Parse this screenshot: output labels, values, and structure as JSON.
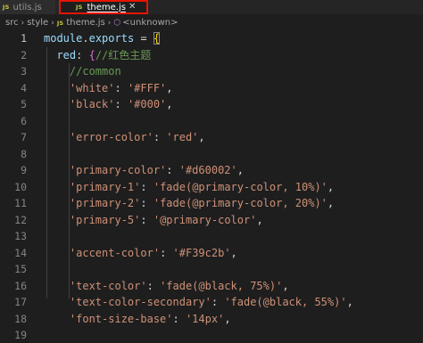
{
  "tabs": [
    {
      "icon": "JS",
      "label": "utils.js"
    },
    {
      "icon": "JS",
      "label": "theme.js",
      "close": "✕"
    }
  ],
  "breadcrumb": {
    "items": [
      "src",
      "style"
    ],
    "separator": "›",
    "file_icon": "JS",
    "file": "theme.js",
    "symbol_icon": "⬡",
    "symbol": "<unknown>"
  },
  "colors": {
    "editor_bg": "#1e1e1e",
    "active_tab_border": "#e51400",
    "js_icon": "#cbcb41",
    "string": "#ce9178",
    "identifier": "#9cdcfe",
    "comment": "#6a9955"
  },
  "editor": {
    "lines": [
      {
        "num": "1",
        "tokens": [
          {
            "t": "module",
            "c": "ident"
          },
          {
            "t": ".",
            "c": "punct"
          },
          {
            "t": "exports",
            "c": "ident"
          },
          {
            "t": " = ",
            "c": "punct"
          },
          {
            "t": "{",
            "c": "bracket"
          }
        ]
      },
      {
        "num": "2",
        "tokens": [
          {
            "t": "red",
            "c": "ident"
          },
          {
            "t": ": ",
            "c": "punct"
          },
          {
            "t": "{",
            "c": "bracket2"
          },
          {
            "t": "//红色主题",
            "c": "comment"
          }
        ]
      },
      {
        "num": "3",
        "tokens": [
          {
            "t": "//common",
            "c": "comment"
          }
        ]
      },
      {
        "num": "4",
        "tokens": [
          {
            "t": "'white'",
            "c": "str"
          },
          {
            "t": ": ",
            "c": "punct"
          },
          {
            "t": "'#FFF'",
            "c": "str"
          },
          {
            "t": ",",
            "c": "punct"
          }
        ]
      },
      {
        "num": "5",
        "tokens": [
          {
            "t": "'black'",
            "c": "str"
          },
          {
            "t": ": ",
            "c": "punct"
          },
          {
            "t": "'#000'",
            "c": "str"
          },
          {
            "t": ",",
            "c": "punct"
          }
        ]
      },
      {
        "num": "6",
        "tokens": []
      },
      {
        "num": "7",
        "tokens": [
          {
            "t": "'error-color'",
            "c": "str"
          },
          {
            "t": ": ",
            "c": "punct"
          },
          {
            "t": "'red'",
            "c": "str"
          },
          {
            "t": ",",
            "c": "punct"
          }
        ]
      },
      {
        "num": "8",
        "tokens": []
      },
      {
        "num": "9",
        "tokens": [
          {
            "t": "'primary-color'",
            "c": "str"
          },
          {
            "t": ": ",
            "c": "punct"
          },
          {
            "t": "'#d60002'",
            "c": "str"
          },
          {
            "t": ",",
            "c": "punct"
          }
        ]
      },
      {
        "num": "10",
        "tokens": [
          {
            "t": "'primary-1'",
            "c": "str"
          },
          {
            "t": ": ",
            "c": "punct"
          },
          {
            "t": "'fade(@primary-color, 10%)'",
            "c": "str"
          },
          {
            "t": ",",
            "c": "punct"
          }
        ]
      },
      {
        "num": "11",
        "tokens": [
          {
            "t": "'primary-2'",
            "c": "str"
          },
          {
            "t": ": ",
            "c": "punct"
          },
          {
            "t": "'fade(@primary-color, 20%)'",
            "c": "str"
          },
          {
            "t": ",",
            "c": "punct"
          }
        ]
      },
      {
        "num": "12",
        "tokens": [
          {
            "t": "'primary-5'",
            "c": "str"
          },
          {
            "t": ": ",
            "c": "punct"
          },
          {
            "t": "'@primary-color'",
            "c": "str"
          },
          {
            "t": ",",
            "c": "punct"
          }
        ]
      },
      {
        "num": "13",
        "tokens": []
      },
      {
        "num": "14",
        "tokens": [
          {
            "t": "'accent-color'",
            "c": "str"
          },
          {
            "t": ": ",
            "c": "punct"
          },
          {
            "t": "'#F39c2b'",
            "c": "str"
          },
          {
            "t": ",",
            "c": "punct"
          }
        ]
      },
      {
        "num": "15",
        "tokens": []
      },
      {
        "num": "16",
        "tokens": [
          {
            "t": "'text-color'",
            "c": "str"
          },
          {
            "t": ": ",
            "c": "punct"
          },
          {
            "t": "'fade(@black, 75%)'",
            "c": "str"
          },
          {
            "t": ",",
            "c": "punct"
          }
        ]
      },
      {
        "num": "17",
        "tokens": [
          {
            "t": "'text-color-secondary'",
            "c": "str"
          },
          {
            "t": ": ",
            "c": "punct"
          },
          {
            "t": "'fade(@black, 55%)'",
            "c": "str"
          },
          {
            "t": ",",
            "c": "punct"
          }
        ]
      },
      {
        "num": "18",
        "tokens": [
          {
            "t": "'font-size-base'",
            "c": "str"
          },
          {
            "t": ": ",
            "c": "punct"
          },
          {
            "t": "'14px'",
            "c": "str"
          },
          {
            "t": ",",
            "c": "punct"
          }
        ]
      },
      {
        "num": "19",
        "tokens": []
      }
    ]
  }
}
